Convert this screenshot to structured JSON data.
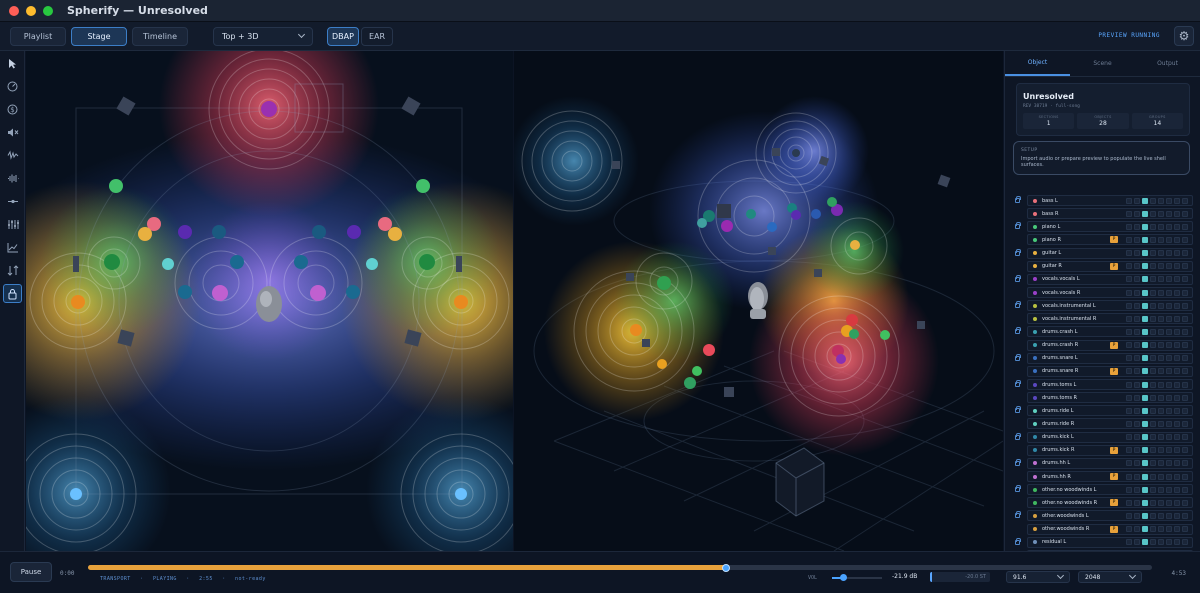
{
  "window": {
    "title": "Spherify — Unresolved"
  },
  "toolbar": {
    "views": [
      "Playlist",
      "Stage",
      "Timeline"
    ],
    "active_view": "Stage",
    "layout_dropdown": "Top + 3D",
    "renderers": [
      "DBAP",
      "EAR"
    ],
    "active_renderer": "DBAP",
    "status": "PREVIEW RUNNING"
  },
  "tools": [
    "pointer-icon",
    "compass-icon",
    "dollar-icon",
    "mute-speaker-icon",
    "waveform-noise-icon",
    "waveform-icon",
    "spread-icon",
    "mixer-faders-icon",
    "chart-icon",
    "sort-icon",
    "lock-icon"
  ],
  "panel": {
    "tabs": [
      "Object",
      "Scene",
      "Output"
    ],
    "active_tab": "Object",
    "project": {
      "title": "Unresolved",
      "meta": "REV 38719  ·  full-song",
      "stats": [
        {
          "label": "SECTIONS",
          "value": "1"
        },
        {
          "label": "OBJECTS",
          "value": "28"
        },
        {
          "label": "GROUPS",
          "value": "14"
        }
      ]
    },
    "setup": {
      "label": "SETUP",
      "text": "Import audio or prepare preview to populate the live shell surfaces."
    },
    "tracks": [
      {
        "name": "bass L",
        "color": "#e8707a",
        "badge": "",
        "locked": true
      },
      {
        "name": "bass R",
        "color": "#e8707a",
        "badge": "",
        "locked": false
      },
      {
        "name": "piano L",
        "color": "#48c87a",
        "badge": "",
        "locked": true
      },
      {
        "name": "piano R",
        "color": "#48c87a",
        "badge": "P",
        "locked": false
      },
      {
        "name": "guitar L",
        "color": "#e8b040",
        "badge": "",
        "locked": true
      },
      {
        "name": "guitar R",
        "color": "#e8b040",
        "badge": "P",
        "locked": false
      },
      {
        "name": "vocals.vocals L",
        "color": "#9a40c8",
        "badge": "",
        "locked": true
      },
      {
        "name": "vocals.vocals R",
        "color": "#9a40c8",
        "badge": "",
        "locked": false
      },
      {
        "name": "vocals.instrumental L",
        "color": "#b8c040",
        "badge": "",
        "locked": true
      },
      {
        "name": "vocals.instrumental R",
        "color": "#b8c040",
        "badge": "",
        "locked": false
      },
      {
        "name": "drums.crash L",
        "color": "#3aa0b0",
        "badge": "",
        "locked": true
      },
      {
        "name": "drums.crash R",
        "color": "#3aa0b0",
        "badge": "P",
        "locked": false
      },
      {
        "name": "drums.snare L",
        "color": "#3a70c0",
        "badge": "",
        "locked": true
      },
      {
        "name": "drums.snare R",
        "color": "#3a70c0",
        "badge": "P",
        "locked": false
      },
      {
        "name": "drums.toms L",
        "color": "#5a48c0",
        "badge": "",
        "locked": true
      },
      {
        "name": "drums.toms R",
        "color": "#5a48c0",
        "badge": "",
        "locked": false
      },
      {
        "name": "drums.ride L",
        "color": "#60d0c0",
        "badge": "",
        "locked": true
      },
      {
        "name": "drums.ride R",
        "color": "#60d0c0",
        "badge": "",
        "locked": false
      },
      {
        "name": "drums.kick L",
        "color": "#3088a8",
        "badge": "",
        "locked": true
      },
      {
        "name": "drums.kick R",
        "color": "#3088a8",
        "badge": "P",
        "locked": false
      },
      {
        "name": "drums.hh L",
        "color": "#c070d0",
        "badge": "",
        "locked": true
      },
      {
        "name": "drums.hh R",
        "color": "#c070d0",
        "badge": "P",
        "locked": false
      },
      {
        "name": "other.no woodwinds L",
        "color": "#40b860",
        "badge": "",
        "locked": true
      },
      {
        "name": "other.no woodwinds R",
        "color": "#40b860",
        "badge": "P",
        "locked": false
      },
      {
        "name": "other.woodwinds L",
        "color": "#d8a040",
        "badge": "",
        "locked": true
      },
      {
        "name": "other.woodwinds R",
        "color": "#d8a040",
        "badge": "P",
        "locked": false
      },
      {
        "name": "residual L",
        "color": "#7090b8",
        "badge": "",
        "locked": true
      },
      {
        "name": "residual R",
        "color": "#7090b8",
        "badge": "",
        "locked": false
      }
    ]
  },
  "transport": {
    "button": "Pause",
    "time_start": "0:00",
    "time_end": "4:53",
    "progress": 0.6,
    "status_items": [
      "TRANSPORT",
      "·",
      "PLAYING",
      "·",
      "2:55",
      "·",
      "not-ready"
    ],
    "vol_label": "VOL",
    "volume": 0.22,
    "db_value": "-21.9 dB",
    "meter_value": "-20.0 ST",
    "rate_dropdown": "91.6",
    "buffer_dropdown": "2048"
  },
  "colors": {
    "accent": "#4a90e2",
    "progress": "#e8a23c",
    "badge": "#e8a13a"
  }
}
